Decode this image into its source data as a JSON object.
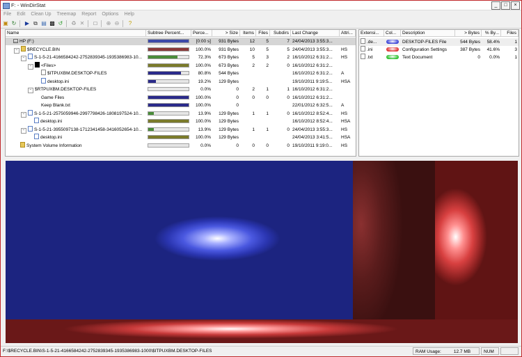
{
  "window": {
    "title": "F: - WinDirStat",
    "buttons": [
      "_",
      "□",
      "×"
    ]
  },
  "menu": [
    "File",
    "Edit",
    "Clean Up",
    "Treemap",
    "Report",
    "Options",
    "Help"
  ],
  "toolbar": {
    "icons": [
      "open-icon",
      "refresh-icon",
      "play-icon",
      "copy-icon",
      "explorer-icon",
      "cmd-icon",
      "refresh-selected-icon",
      "recycle-icon",
      "delete-icon",
      "new-folder-icon",
      "zoom-in-icon",
      "zoom-out-icon",
      "help-icon"
    ]
  },
  "tree": {
    "columns": [
      "Name",
      "Subtree Percent...",
      "Perce...",
      "> Size",
      "Items",
      "Files",
      "Subdirs",
      "Last Change",
      "Attri..."
    ],
    "rows": [
      {
        "name": "HP (F:)",
        "level": 0,
        "icon": "drive",
        "toggle": "",
        "bar": 1.0,
        "bar_color": "#3c48a8",
        "percent": "[0:00 s]",
        "size": "931 Bytes",
        "items": "12",
        "files": "5",
        "subdirs": "7",
        "last_change": "24/04/2013  3:55:3...",
        "attr": "",
        "selected": true
      },
      {
        "name": "$RECYCLE.BIN",
        "level": 1,
        "icon": "folder",
        "toggle": "−",
        "bar": 1.0,
        "bar_color": "#8b3a3a",
        "percent": "100.0%",
        "size": "931 Bytes",
        "items": "10",
        "files": "5",
        "subdirs": "5",
        "last_change": "24/04/2013  3:55:3...",
        "attr": "HS"
      },
      {
        "name": "S-1-5-21-4166584242-2752839345-1935386983-10...",
        "level": 2,
        "icon": "cfg",
        "toggle": "−",
        "bar": 0.723,
        "bar_color": "#4a8c3a",
        "percent": "72.3%",
        "size": "673 Bytes",
        "items": "5",
        "files": "3",
        "subdirs": "2",
        "last_change": "16/10/2012  6:31:2...",
        "attr": "HS"
      },
      {
        "name": "<Files>",
        "level": 3,
        "icon": "black",
        "toggle": "−",
        "bar": 1.0,
        "bar_color": "#7a7a2a",
        "percent": "100.0%",
        "size": "673 Bytes",
        "items": "2",
        "files": "2",
        "subdirs": "0",
        "last_change": "16/10/2012  6:31:2...",
        "attr": ""
      },
      {
        "name": "$ITPUXBM.DESKTOP-FILES",
        "level": 4,
        "icon": "file",
        "toggle": "",
        "bar": 0.808,
        "bar_color": "#2a2a8a",
        "percent": "80.8%",
        "size": "544 Bytes",
        "items": "",
        "files": "",
        "subdirs": "",
        "last_change": "16/10/2012  6:31:2...",
        "attr": "A"
      },
      {
        "name": "desktop.ini",
        "level": 4,
        "icon": "cfg",
        "toggle": "",
        "bar": 0.192,
        "bar_color": "#2a2a8a",
        "percent": "19.2%",
        "size": "129 Bytes",
        "items": "",
        "files": "",
        "subdirs": "",
        "last_change": "19/10/2011  9:19:5...",
        "attr": "HSA"
      },
      {
        "name": "$RTPUXBM.DESKTOP-FILES",
        "level": 3,
        "icon": "none",
        "toggle": "−",
        "bar": 0.0,
        "bar_color": "#2a2a8a",
        "percent": "0.0%",
        "size": "0",
        "items": "2",
        "files": "1",
        "subdirs": "1",
        "last_change": "16/10/2012  6:31:2...",
        "attr": ""
      },
      {
        "name": "Game Files",
        "level": 4,
        "icon": "none",
        "toggle": "",
        "bar": 1.0,
        "bar_color": "#2a2a8a",
        "percent": "100.0%",
        "size": "0",
        "items": "0",
        "files": "0",
        "subdirs": "0",
        "last_change": "16/10/2012  6:31:2...",
        "attr": ""
      },
      {
        "name": "Keep Blank.txt",
        "level": 4,
        "icon": "none",
        "toggle": "",
        "bar": 1.0,
        "bar_color": "#2a2a8a",
        "percent": "100.0%",
        "size": "0",
        "items": "",
        "files": "",
        "subdirs": "",
        "last_change": "22/01/2012  6:32:5...",
        "attr": "A"
      },
      {
        "name": "S-1-5-21-2575059946-2997798426-1808197524-10...",
        "level": 2,
        "icon": "cfg",
        "toggle": "−",
        "bar": 0.139,
        "bar_color": "#4a8c3a",
        "percent": "13.9%",
        "size": "129 Bytes",
        "items": "1",
        "files": "1",
        "subdirs": "0",
        "last_change": "16/10/2012  8:52:4...",
        "attr": "HS"
      },
      {
        "name": "desktop.ini",
        "level": 3,
        "icon": "cfg",
        "toggle": "",
        "bar": 1.0,
        "bar_color": "#7a7a2a",
        "percent": "100.0%",
        "size": "129 Bytes",
        "items": "",
        "files": "",
        "subdirs": "",
        "last_change": "16/10/2012  8:52:4...",
        "attr": "HSA"
      },
      {
        "name": "S-1-5-21-3955097138-1712341458-3416052654-10...",
        "level": 2,
        "icon": "cfg",
        "toggle": "−",
        "bar": 0.139,
        "bar_color": "#4a8c3a",
        "percent": "13.9%",
        "size": "129 Bytes",
        "items": "1",
        "files": "1",
        "subdirs": "0",
        "last_change": "24/04/2013  3:55:3...",
        "attr": "HS"
      },
      {
        "name": "desktop.ini",
        "level": 3,
        "icon": "cfg",
        "toggle": "",
        "bar": 1.0,
        "bar_color": "#7a7a2a",
        "percent": "100.0%",
        "size": "129 Bytes",
        "items": "",
        "files": "",
        "subdirs": "",
        "last_change": "24/04/2013  3:41:5...",
        "attr": "HSA"
      },
      {
        "name": "System Volume Information",
        "level": 1,
        "icon": "folder",
        "toggle": "",
        "bar": 0.0,
        "bar_color": "#8b3a3a",
        "percent": "0.0%",
        "size": "0",
        "items": "0",
        "files": "0",
        "subdirs": "0",
        "last_change": "19/10/2011  9:19:0...",
        "attr": "HS"
      }
    ]
  },
  "extensions": {
    "columns": [
      "Extensi...",
      "Col...",
      "Description",
      "> Bytes",
      "% By...",
      "Files"
    ],
    "rows": [
      {
        "ext": ".de...",
        "color": "#3c44d8",
        "description": "DESKTOP-FILES File",
        "bytes": "544 Bytes",
        "percent": "58.4%",
        "files": "1",
        "selected": true
      },
      {
        "ext": ".ini",
        "color": "#e03030",
        "description": "Configuration Settings",
        "bytes": "387 Bytes",
        "percent": "41.6%",
        "files": "3"
      },
      {
        "ext": ".txt",
        "color": "#30c030",
        "description": "Text Document",
        "bytes": "0",
        "percent": "0.0%",
        "files": "1"
      }
    ]
  },
  "treemap": {
    "color_blue": "#2c3cc8",
    "color_red": "#d84040"
  },
  "status": {
    "path": "F:\\$RECYCLE.BIN\\S-1-5-21-4166584242-2752839345-1935386983-1000\\$ITPUXBM.DESKTOP-FILES",
    "ram_label": "RAM Usage:",
    "ram_value": "12.7 MB",
    "num": "NUM"
  }
}
